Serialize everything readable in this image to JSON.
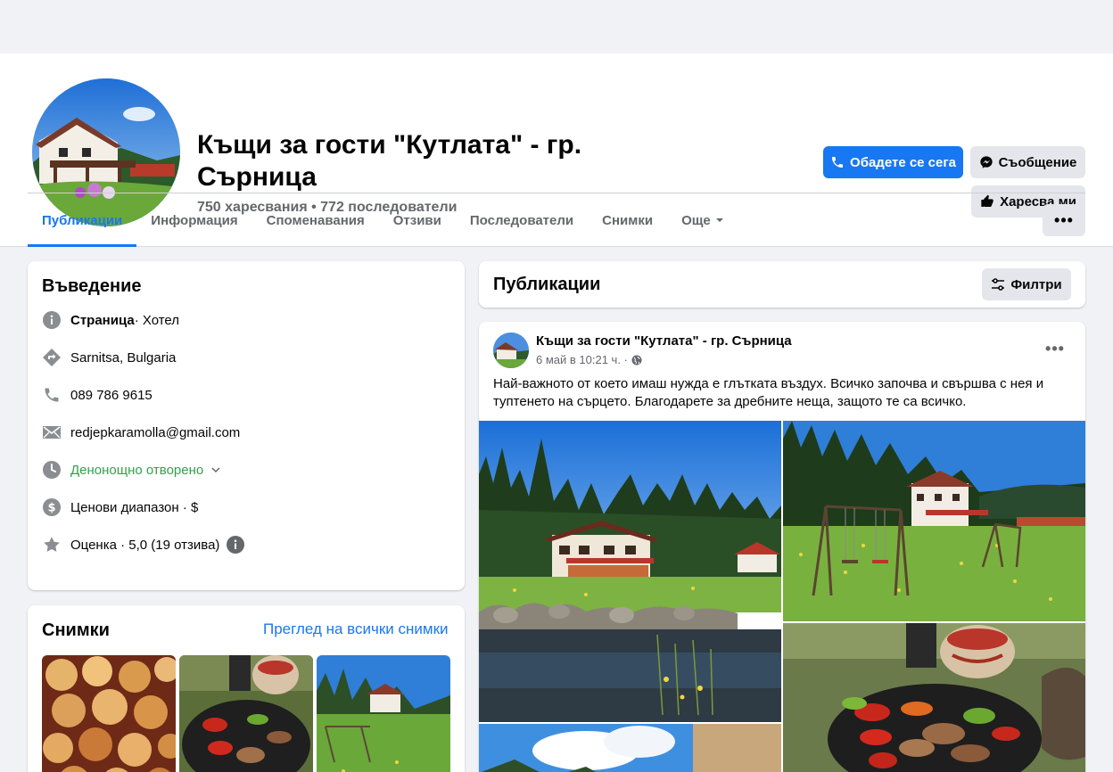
{
  "page": {
    "title": "Къщи за гости \"Кутлата\" - гр. Сърница",
    "stats": "750 харесвания • 772 последователи"
  },
  "actions": {
    "call": "Обадете се сега",
    "message": "Съобщение",
    "like": "Харесва ми"
  },
  "tabs": [
    {
      "label": "Публикации",
      "active": true
    },
    {
      "label": "Информация"
    },
    {
      "label": "Споменавания"
    },
    {
      "label": "Отзиви"
    },
    {
      "label": "Последователи"
    },
    {
      "label": "Снимки"
    },
    {
      "label": "Още"
    }
  ],
  "more_dots": "•••",
  "intro": {
    "title": "Въведение",
    "category_label": "Страница",
    "category_value": " · Хотел",
    "location": "Sarnitsa, Bulgaria",
    "phone": "089 786 9615",
    "email": "redjepkaramolla@gmail.com",
    "hours": "Денонощно отворено",
    "price": "Ценови диапазон · $",
    "rating": "Оценка · 5,0 (19 отзива)"
  },
  "photos": {
    "title": "Снимки",
    "see_all": "Преглед на всички снимки"
  },
  "posts": {
    "title": "Публикации",
    "filters": "Филтри"
  },
  "post": {
    "author": "Къщи за гости \"Кутлата\" - гр. Сърница",
    "time": "6 май в 10:21 ч. ·",
    "text": "Най-важното от което имаш нужда е глътката въздух. Всичко започва и свършва с нея и туптенето на сърцето. Благодарете за дребните неща, защото те са всичко.",
    "dots": "•••"
  },
  "colors": {
    "accent": "#1877f2",
    "open_green": "#31a24c",
    "secondary_text": "#65676b"
  },
  "icons": [
    "phone-icon",
    "messenger-icon",
    "thumbs-up-icon",
    "info-icon",
    "directions-icon",
    "email-icon",
    "clock-icon",
    "dollar-icon",
    "star-icon",
    "filters-icon",
    "globe-icon",
    "chevron-down-icon"
  ]
}
